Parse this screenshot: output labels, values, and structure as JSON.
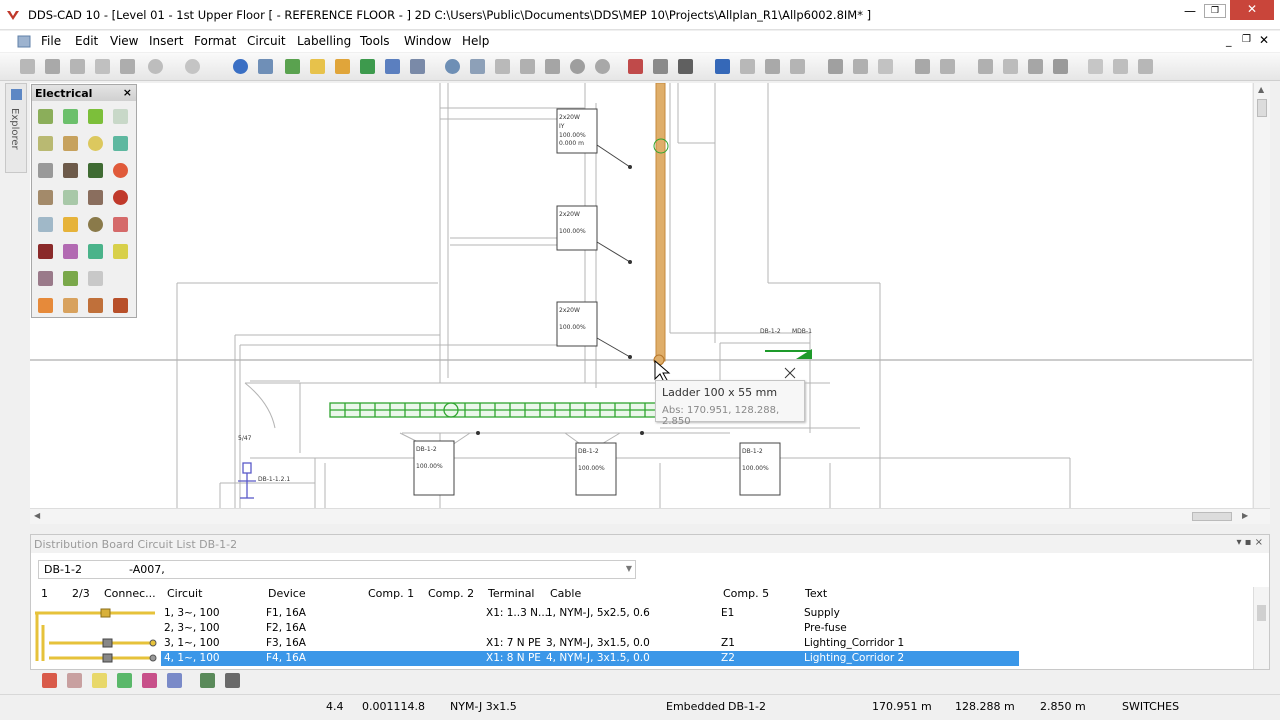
{
  "window": {
    "title": "DDS-CAD 10 - [Level 01 - 1st Upper Floor  [ - REFERENCE FLOOR - ]  2D  C:\\Users\\Public\\Documents\\DDS\\MEP 10\\Projects\\Allplan_R1\\Allp6002.8IM* ]"
  },
  "menu": [
    "File",
    "Edit",
    "View",
    "Insert",
    "Format",
    "Circuit",
    "Labelling",
    "Tools",
    "Window",
    "Help"
  ],
  "sidebar": {
    "explorer_label": "Explorer"
  },
  "palette": {
    "title": "Electrical",
    "close": "×"
  },
  "drawing": {
    "fixture_label_lines": [
      "2x20W",
      "IY",
      "100.00%",
      "0.000 m",
      "0.00A"
    ],
    "db_label": "DB-1-2",
    "mdb_label": "MDB-1",
    "small_label_1": "5/47",
    "small_label_2": "DB-1-1.2.1"
  },
  "tooltip": {
    "title": "Ladder 100 x 55 mm",
    "coords": "Abs: 170.951, 128.288, 2.850"
  },
  "circuit_list": {
    "panel_title": "Distribution Board Circuit List DB-1-2",
    "panel_buttons": "▾  ▪  ×",
    "board": "DB-1-2",
    "filter": "-A007,",
    "columns": [
      "1",
      "2/3",
      "Connec...",
      "Circuit",
      "Device",
      "Comp. 1",
      "Comp. 2",
      "Terminal",
      "Cable",
      "Comp. 5",
      "Text"
    ],
    "rows": [
      {
        "circuit": "1, 3~, 100",
        "device": "F1, 16A",
        "terminal": "X1: 1..3 N...",
        "cable": "1, NYM-J, 5x2.5, 0.6",
        "comp5": "E1",
        "text": "Supply",
        "selected": false
      },
      {
        "circuit": "2, 3~, 100",
        "device": "F2, 16A",
        "terminal": "",
        "cable": "",
        "comp5": "",
        "text": "Pre-fuse",
        "selected": false
      },
      {
        "circuit": "3, 1~, 100",
        "device": "F3, 16A",
        "terminal": "X1: 7 N PE",
        "cable": "3, NYM-J, 3x1.5, 0.0",
        "comp5": "Z1",
        "text": "Lighting_Corridor 1",
        "selected": false
      },
      {
        "circuit": "4, 1~, 100",
        "device": "F4, 16A",
        "terminal": "X1: 8 N PE",
        "cable": "4, NYM-J, 3x1.5, 0.0",
        "comp5": "Z2",
        "text": "Lighting_Corridor 2",
        "selected": true
      }
    ]
  },
  "status": {
    "s1": "4.4",
    "s2": "0.001114.8",
    "s3": "NYM-J 3x1.5",
    "s4": "Embedded",
    "s5": "DB-1-2",
    "x": "170.951 m",
    "y": "128.288 m",
    "z": "2.850 m",
    "mode": "SWITCHES"
  },
  "colors": {
    "accent_selection": "#3b97e8",
    "ladder": "#d8a25e",
    "cable_tray": "#2fa52f"
  }
}
